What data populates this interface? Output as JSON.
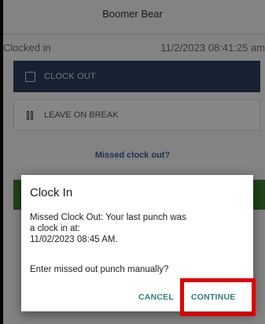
{
  "header": {
    "user_name": "Boomer Bear"
  },
  "status": {
    "label": "Clocked in",
    "timestamp": "11/2/2023 08:41:25 am"
  },
  "actions": {
    "clock_out_label": "CLOCK OUT",
    "break_label": "LEAVE ON BREAK",
    "missed_link_label": "Missed clock out?"
  },
  "dialog": {
    "title": "Clock In",
    "message_lines": [
      "Missed Clock Out: Your last punch was",
      "a clock in at:",
      "11/02/2023 08:45 AM."
    ],
    "question": "Enter missed out punch manually?",
    "cancel_label": "CANCEL",
    "continue_label": "CONTINUE"
  },
  "colors": {
    "primary_button": "#2a3f5c",
    "link": "#3b5e8f",
    "success_strip": "#3f7a32",
    "dialog_action": "#2e7d7d",
    "highlight": "#e00000"
  },
  "icons": {
    "clock_out": "checkbox-icon",
    "break": "pause-icon"
  }
}
